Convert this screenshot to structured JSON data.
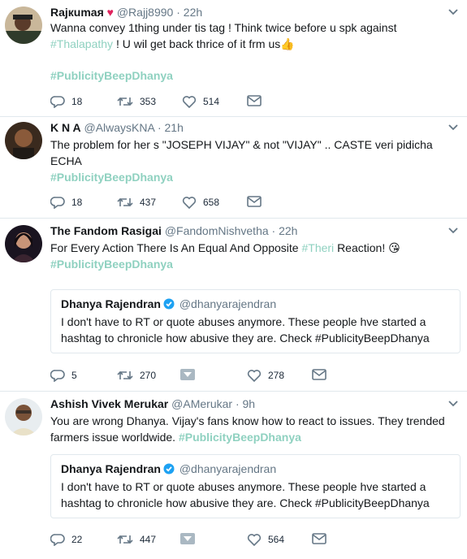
{
  "tweets": [
    {
      "name": "Rajкumaя",
      "handle": "@Rajj8990",
      "time": "22h",
      "text_a": "Wanna convey 1thing under tis tag ! Think twice before u spk against",
      "text_hash": "#Thalapathy",
      "text_b": " ! U wil get back thrice of it frm us",
      "emoji": "👍",
      "tag": "#PublicityBeepDhanya",
      "replies": "18",
      "retweets": "353",
      "likes": "514"
    },
    {
      "name": "K N A",
      "handle": "@AlwaysKNA",
      "time": "21h",
      "text": "The problem for her s \"JOSEPH VIJAY\" & not \"VIJAY\" .. CASTE veri pidicha ECHA",
      "tag": "#PublicityBeepDhanya",
      "replies": "18",
      "retweets": "437",
      "likes": "658"
    },
    {
      "name": "The Fandom Rasigai",
      "handle": "@FandomNishvetha",
      "time": "22h",
      "text_a": "For Every Action There Is An Equal And Opposite",
      "text_hash": "#Theri",
      "text_b": "Reaction!",
      "emoji": "😘",
      "tag": "#PublicityBeepDhanya",
      "quote": {
        "name": "Dhanya Rajendran",
        "handle": "@dhanyarajendran",
        "text": "I don't have to RT or quote abuses anymore. These people hve started a hashtag to chronicle how abusive they are. Check #PublicityBeepDhanya"
      },
      "replies": "5",
      "retweets": "270",
      "likes": "278"
    },
    {
      "name": "Ashish Vivek Merukar",
      "handle": "@AMerukar",
      "time": "9h",
      "text_a": "You are wrong Dhanya. Vijay's fans know how to react to issues. They trended farmers issue worldwide.",
      "tag": "#PublicityBeepDhanya",
      "quote": {
        "name": "Dhanya Rajendran",
        "handle": "@dhanyarajendran",
        "text": "I don't have to RT or quote abuses anymore. These people hve started a hashtag to chronicle how abusive they are. Check #PublicityBeepDhanya"
      },
      "replies": "22",
      "retweets": "447",
      "likes": "564"
    }
  ],
  "colors": {
    "hashtag": "#8fd1c0",
    "meta": "#657786",
    "verified": "#1da1f2",
    "heart": "#e0245e"
  },
  "icons": [
    "reply-icon",
    "retweet-icon",
    "like-icon",
    "dm-icon",
    "caret-icon",
    "verified-icon"
  ]
}
